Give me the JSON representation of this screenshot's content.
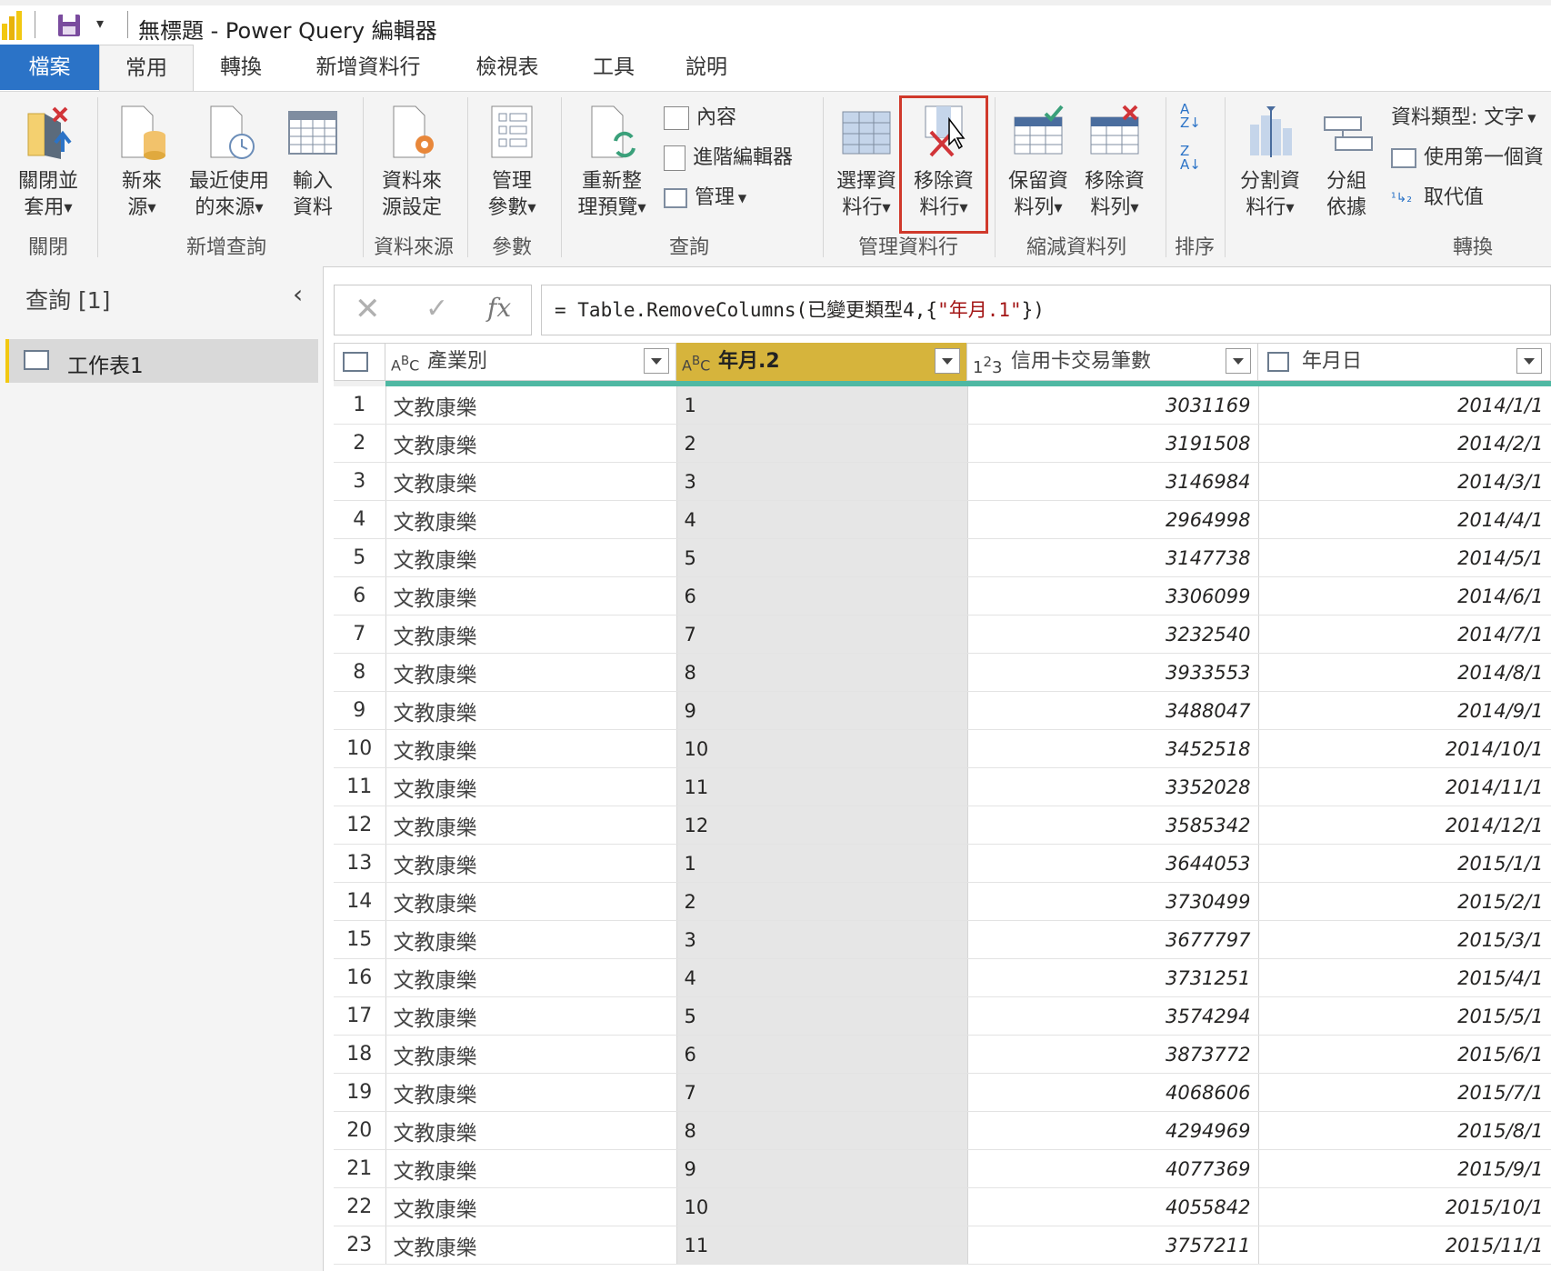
{
  "title": "無標題 - Power Query 編輯器",
  "tabs": [
    {
      "label": "檔案"
    },
    {
      "label": "常用"
    },
    {
      "label": "轉換"
    },
    {
      "label": "新增資料行"
    },
    {
      "label": "檢視表"
    },
    {
      "label": "工具"
    },
    {
      "label": "說明"
    }
  ],
  "ribbon": {
    "close_apply": [
      "關閉並",
      "套用"
    ],
    "new_source": [
      "新來",
      "源"
    ],
    "recent_sources": [
      "最近使用",
      "的來源"
    ],
    "enter_data": [
      "輸入",
      "資料"
    ],
    "data_source_settings": [
      "資料來",
      "源設定"
    ],
    "manage_params": [
      "管理",
      "參數"
    ],
    "refresh_preview": [
      "重新整",
      "理預覽"
    ],
    "properties": "內容",
    "advanced_editor": "進階編輯器",
    "manage": "管理",
    "choose_columns": [
      "選擇資",
      "料行"
    ],
    "remove_columns": [
      "移除資",
      "料行"
    ],
    "keep_rows": [
      "保留資",
      "料列"
    ],
    "remove_rows": [
      "移除資",
      "料列"
    ],
    "split_column": [
      "分割資",
      "料行"
    ],
    "group_by": [
      "分組",
      "依據"
    ],
    "data_type": "資料類型: 文字",
    "use_first_row": "使用第一個資",
    "replace_values": "取代值",
    "groups": {
      "close": "關閉",
      "new_query": "新增查詢",
      "data_sources": "資料來源",
      "parameters": "參數",
      "query": "查詢",
      "manage_columns": "管理資料行",
      "reduce_rows": "縮減資料列",
      "sort": "排序",
      "transform": "轉換"
    }
  },
  "queries": {
    "header": "查詢 [1]",
    "items": [
      {
        "label": "工作表1"
      }
    ]
  },
  "formula": {
    "fx": "fx",
    "text_prefix": "= Table.RemoveColumns(已變更類型4,{",
    "text_string": "\"年月.1\"",
    "text_suffix": "})"
  },
  "columns": [
    {
      "type": "ABC",
      "name": "產業別"
    },
    {
      "type": "ABC",
      "name": "年月.2"
    },
    {
      "type": "123",
      "name": "信用卡交易筆數"
    },
    {
      "type": "date",
      "name": "年月日"
    }
  ],
  "rows": [
    {
      "i": "1",
      "a": "文教康樂",
      "b": "1",
      "c": "3031169",
      "d": "2014/1/1"
    },
    {
      "i": "2",
      "a": "文教康樂",
      "b": "2",
      "c": "3191508",
      "d": "2014/2/1"
    },
    {
      "i": "3",
      "a": "文教康樂",
      "b": "3",
      "c": "3146984",
      "d": "2014/3/1"
    },
    {
      "i": "4",
      "a": "文教康樂",
      "b": "4",
      "c": "2964998",
      "d": "2014/4/1"
    },
    {
      "i": "5",
      "a": "文教康樂",
      "b": "5",
      "c": "3147738",
      "d": "2014/5/1"
    },
    {
      "i": "6",
      "a": "文教康樂",
      "b": "6",
      "c": "3306099",
      "d": "2014/6/1"
    },
    {
      "i": "7",
      "a": "文教康樂",
      "b": "7",
      "c": "3232540",
      "d": "2014/7/1"
    },
    {
      "i": "8",
      "a": "文教康樂",
      "b": "8",
      "c": "3933553",
      "d": "2014/8/1"
    },
    {
      "i": "9",
      "a": "文教康樂",
      "b": "9",
      "c": "3488047",
      "d": "2014/9/1"
    },
    {
      "i": "10",
      "a": "文教康樂",
      "b": "10",
      "c": "3452518",
      "d": "2014/10/1"
    },
    {
      "i": "11",
      "a": "文教康樂",
      "b": "11",
      "c": "3352028",
      "d": "2014/11/1"
    },
    {
      "i": "12",
      "a": "文教康樂",
      "b": "12",
      "c": "3585342",
      "d": "2014/12/1"
    },
    {
      "i": "13",
      "a": "文教康樂",
      "b": "1",
      "c": "3644053",
      "d": "2015/1/1"
    },
    {
      "i": "14",
      "a": "文教康樂",
      "b": "2",
      "c": "3730499",
      "d": "2015/2/1"
    },
    {
      "i": "15",
      "a": "文教康樂",
      "b": "3",
      "c": "3677797",
      "d": "2015/3/1"
    },
    {
      "i": "16",
      "a": "文教康樂",
      "b": "4",
      "c": "3731251",
      "d": "2015/4/1"
    },
    {
      "i": "17",
      "a": "文教康樂",
      "b": "5",
      "c": "3574294",
      "d": "2015/5/1"
    },
    {
      "i": "18",
      "a": "文教康樂",
      "b": "6",
      "c": "3873772",
      "d": "2015/6/1"
    },
    {
      "i": "19",
      "a": "文教康樂",
      "b": "7",
      "c": "4068606",
      "d": "2015/7/1"
    },
    {
      "i": "20",
      "a": "文教康樂",
      "b": "8",
      "c": "4294969",
      "d": "2015/8/1"
    },
    {
      "i": "21",
      "a": "文教康樂",
      "b": "9",
      "c": "4077369",
      "d": "2015/9/1"
    },
    {
      "i": "22",
      "a": "文教康樂",
      "b": "10",
      "c": "4055842",
      "d": "2015/10/1"
    },
    {
      "i": "23",
      "a": "文教康樂",
      "b": "11",
      "c": "3757211",
      "d": "2015/11/1"
    }
  ],
  "colors": {
    "file_tab": "#2b73c7",
    "selected_column_header": "#d6b43c",
    "highlight_box": "#d0392b",
    "column_quality_bar": "#4fb8a3"
  }
}
